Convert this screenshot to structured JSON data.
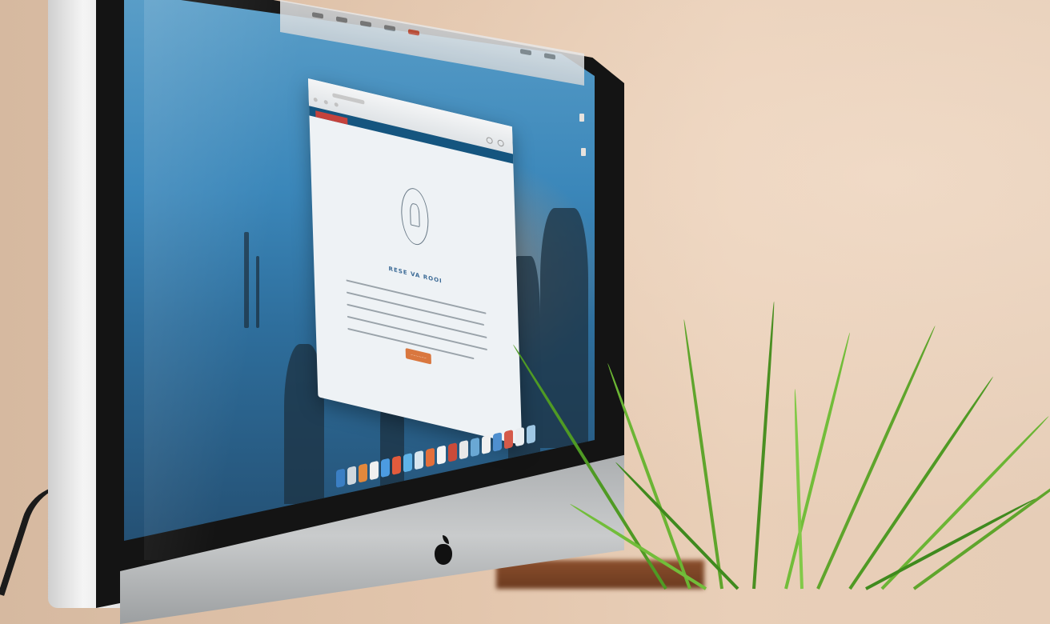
{
  "scene": {
    "description_kind": "photo of an iMac on a desk with a plant"
  },
  "dialog": {
    "heading": "RESE VA ROOI",
    "button_label": "~~~~~~"
  },
  "colors": {
    "wall": "#e3c6ad",
    "navbar": "#15557f",
    "button": "#d9773f",
    "plant": "#5fa52c"
  }
}
